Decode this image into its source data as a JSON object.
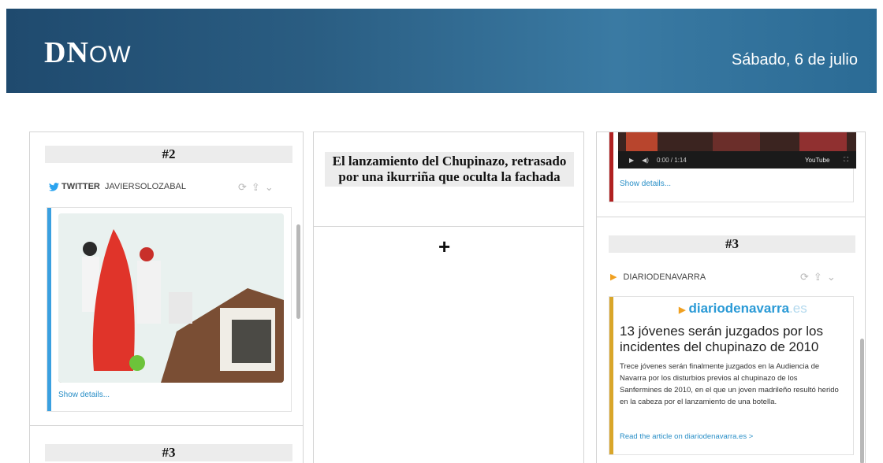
{
  "header": {
    "logo_dn": "DN",
    "logo_ow": "OW",
    "date": "Sábado, 6 de julio"
  },
  "left_column": {
    "top_number": "#2",
    "source_network": "TWITTER",
    "source_user": "JAVIERSOLOZABAL",
    "show_details": "Show details...",
    "bottom_number": "#3",
    "accent_color": "#3aa0e0"
  },
  "middle_column": {
    "headline": "El lanzamiento del Chupinazo, retrasado por una ikurriña que oculta la fachada",
    "add_symbol": "+"
  },
  "right_column": {
    "video_time": "0:00 / 1:14",
    "video_brand": "YouTube",
    "show_details": "Show details...",
    "number": "#3",
    "source_name": "DIARIODENAVARRA",
    "publisher_logo": "diariodenavarra",
    "publisher_tld": ".es",
    "article_title": "13 jóvenes serán juzgados por los incidentes del chupinazo de 2010",
    "article_body": "Trece jóvenes serán finalmente juzgados en la Audiencia de Navarra por los disturbios previos al chupinazo de los Sanfermines de 2010, en el que un joven madrileño resultó herido en la cabeza por el lanzamiento de una botella.",
    "read_link": "Read the article on diariodenavarra.es >",
    "accent_color": "#d9a62a",
    "video_accent_color": "#b02020"
  },
  "icons": [
    "twitter-bird-icon",
    "retweet-icon",
    "share-icon",
    "chevron-down-icon",
    "play-icon",
    "volume-icon",
    "fullscreen-icon",
    "source-triangle-icon"
  ]
}
